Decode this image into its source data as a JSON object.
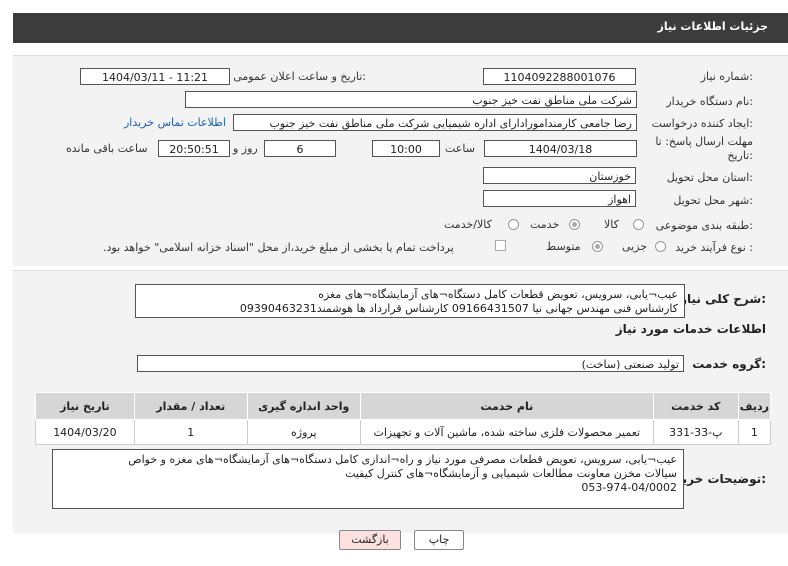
{
  "header": {
    "title": "جزئیات اطلاعات نیاز"
  },
  "form": {
    "need_number_label": "شماره نیاز:",
    "need_number": "1104092288001076",
    "announce_label": "تاریخ و ساعت اعلان عمومی:",
    "announce_value": "1404/03/11 - 11:21",
    "buyer_label": "نام دستگاه خریدار:",
    "buyer_value": "شرکت ملی مناطق نفت خیز جنوب",
    "requester_label": "ایجاد کننده درخواست:",
    "requester_value": "رضا جامعی کارمندامورادارای اداره شیمیایی شرکت ملی مناطق نفت خیز جنوب",
    "buyer_contact_link": "اطلاعات تماس خریدار",
    "deadline_label": "مهلت ارسال پاسخ: تا تاریخ:",
    "deadline_date": "1404/03/18",
    "time_label": "ساعت",
    "deadline_time": "10:00",
    "days_value": "6",
    "days_label": "روز و",
    "remaining_time": "20:50:51",
    "remaining_label": "ساعت باقی مانده",
    "province_label": "استان محل تحویل:",
    "province_value": "خوزستان",
    "city_label": "شهر محل تحویل:",
    "city_value": "اهواز",
    "category_label": "طبقه بندی موضوعی:",
    "category_options": [
      "کالا",
      "خدمت",
      "کالا/خدمت"
    ],
    "process_label": "نوع فرآیند خرید :",
    "process_options": [
      "جزیی",
      "متوسط"
    ],
    "payment_note": "پرداخت تمام یا بخشی از مبلغ خرید،از محل \"اسناد خزانه اسلامی\" خواهد بود."
  },
  "summary": {
    "label": "شرح کلی نیاز:",
    "line1": "عیب¬یابی، سرویس، تعویض قطعات  کامل دستگاه¬های آزمایشگاه¬های مغزه",
    "line2": "کارشناس فنی مهندس جهانی نیا 09166431507 کارشناس قرارداد ها هوشمند09390463231"
  },
  "services": {
    "section_title": "اطلاعات خدمات مورد نیاز",
    "group_label": "گروه خدمت:",
    "group_value": "تولید صنعتی (ساخت)",
    "columns": [
      "ردیف",
      "کد خدمت",
      "نام خدمت",
      "واحد اندازه گیری",
      "تعداد / مقدار",
      "تاریخ نیاز"
    ],
    "rows": [
      {
        "index": "1",
        "code": "پ-33-331",
        "name": "تعمیر محصولات فلزی ساخته شده، ماشین آلات و تجهیزات",
        "unit": "پروژه",
        "qty": "1",
        "date": "1404/03/20"
      }
    ]
  },
  "buyer_notes": {
    "label": "توضیحات خریدار:",
    "line1": "عیب¬یابی، سرویس، تعویض قطعات مصرفی مورد نیاز و راه¬اندازی کامل دستگاه¬های آزمایشگاه¬های مغزه و خواص",
    "line2": "سیالات مخزن معاونت مطالعات شیمیایی و آزمایشگاه¬های کنترل کیفیت",
    "line3": "053-974-04/0002"
  },
  "buttons": {
    "print": "چاپ",
    "back": "بازگشت"
  },
  "colors": {
    "header_bg": "#3c3c3c",
    "link": "#1a5fb4",
    "back_btn_bg": "#fde0e0",
    "watermark": "#e8c9c9"
  }
}
